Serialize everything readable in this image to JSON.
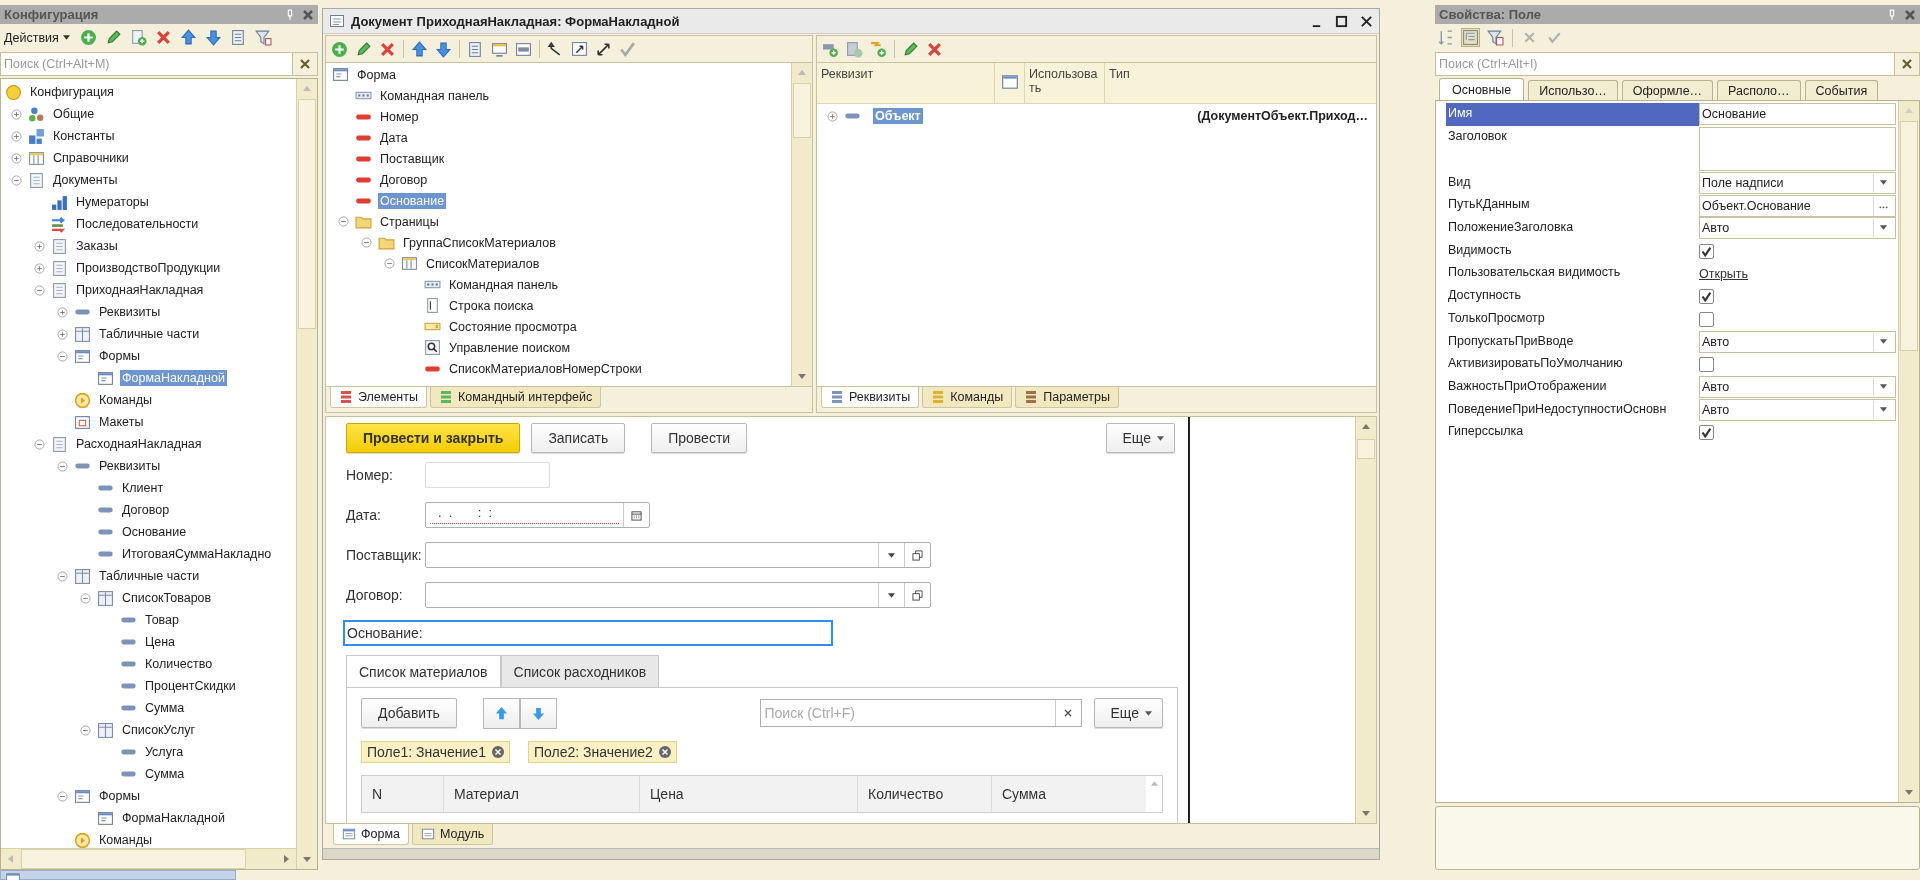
{
  "config_panel": {
    "title": "Конфигурация",
    "actions": "Действия",
    "search": {
      "placeholder": "Поиск (Ctrl+Alt+M)"
    },
    "tree": [
      {
        "label": "Конфигурация",
        "kind": "config",
        "selected": false,
        "children": [
          {
            "label": "Общие",
            "kind": "common",
            "expanded": false,
            "selected": false
          },
          {
            "label": "Константы",
            "kind": "constants",
            "expanded": false,
            "selected": false
          },
          {
            "label": "Справочники",
            "kind": "catalogs",
            "expanded": false,
            "selected": false
          },
          {
            "label": "Документы",
            "kind": "document",
            "expanded": true,
            "selected": false,
            "children": [
              {
                "label": "Нумераторы",
                "kind": "numerators",
                "selected": false
              },
              {
                "label": "Последовательности",
                "kind": "sequences",
                "selected": false
              },
              {
                "label": "Заказы",
                "kind": "document",
                "expanded": false,
                "selected": false
              },
              {
                "label": "ПроизводствоПродукции",
                "kind": "document",
                "expanded": false,
                "selected": false
              },
              {
                "label": "ПриходнаяНакладная",
                "kind": "document",
                "expanded": true,
                "selected": false,
                "children": [
                  {
                    "label": "Реквизиты",
                    "kind": "attr",
                    "expanded": false,
                    "selected": false
                  },
                  {
                    "label": "Табличные части",
                    "kind": "tabular",
                    "expanded": false,
                    "selected": false
                  },
                  {
                    "label": "Формы",
                    "kind": "form",
                    "expanded": true,
                    "selected": false,
                    "children": [
                      {
                        "label": "ФормаНакладной",
                        "kind": "form",
                        "selected": true
                      }
                    ]
                  },
                  {
                    "label": "Команды",
                    "kind": "commands",
                    "selected": false
                  },
                  {
                    "label": "Макеты",
                    "kind": "layouts",
                    "selected": false
                  }
                ]
              },
              {
                "label": "РасходнаяНакладная",
                "kind": "document",
                "expanded": true,
                "selected": false,
                "children": [
                  {
                    "label": "Реквизиты",
                    "kind": "attr",
                    "expanded": true,
                    "selected": false,
                    "children": [
                      {
                        "label": "Клиент",
                        "kind": "attr",
                        "selected": false
                      },
                      {
                        "label": "Договор",
                        "kind": "attr",
                        "selected": false
                      },
                      {
                        "label": "Основание",
                        "kind": "attr",
                        "selected": false
                      },
                      {
                        "label": "ИтоговаяСуммаНакладно",
                        "kind": "attr",
                        "selected": false
                      }
                    ]
                  },
                  {
                    "label": "Табличные части",
                    "kind": "tabular",
                    "expanded": true,
                    "selected": false,
                    "children": [
                      {
                        "label": "СписокТоваров",
                        "kind": "tabular",
                        "expanded": true,
                        "selected": false,
                        "children": [
                          {
                            "label": "Товар",
                            "kind": "attr",
                            "selected": false
                          },
                          {
                            "label": "Цена",
                            "kind": "attr",
                            "selected": false
                          },
                          {
                            "label": "Количество",
                            "kind": "attr",
                            "selected": false
                          },
                          {
                            "label": "ПроцентСкидки",
                            "kind": "attr",
                            "selected": false
                          },
                          {
                            "label": "Сумма",
                            "kind": "attr",
                            "selected": false
                          }
                        ]
                      },
                      {
                        "label": "СписокУслуг",
                        "kind": "tabular",
                        "expanded": true,
                        "selected": false,
                        "children": [
                          {
                            "label": "Услуга",
                            "kind": "attr",
                            "selected": false
                          },
                          {
                            "label": "Сумма",
                            "kind": "attr",
                            "selected": false
                          }
                        ]
                      }
                    ]
                  },
                  {
                    "label": "Формы",
                    "kind": "form",
                    "expanded": true,
                    "selected": false,
                    "children": [
                      {
                        "label": "ФормаНакладной",
                        "kind": "form",
                        "selected": false
                      }
                    ]
                  },
                  {
                    "label": "Команды",
                    "kind": "commands",
                    "selected": false
                  }
                ]
              }
            ]
          }
        ]
      }
    ]
  },
  "designer": {
    "title": "Документ ПриходнаяНакладная: ФормаНакладной",
    "elements_tree": [
      {
        "label": "Форма",
        "kind": "form",
        "selected": false,
        "children": [
          {
            "label": "Командная панель",
            "kind": "cmdpanel",
            "selected": false
          },
          {
            "label": "Номер",
            "kind": "field",
            "selected": false
          },
          {
            "label": "Дата",
            "kind": "field",
            "selected": false
          },
          {
            "label": "Поставщик",
            "kind": "field",
            "selected": false
          },
          {
            "label": "Договор",
            "kind": "field",
            "selected": false
          },
          {
            "label": "Основание",
            "kind": "field",
            "selected": true
          },
          {
            "label": "Страницы",
            "kind": "folder",
            "expanded": true,
            "selected": false,
            "children": [
              {
                "label": "ГруппаСписокМатериалов",
                "kind": "folder",
                "expanded": true,
                "selected": false,
                "children": [
                  {
                    "label": "СписокМатериалов",
                    "kind": "catalogs",
                    "expanded": true,
                    "selected": false,
                    "children": [
                      {
                        "label": "Командная панель",
                        "kind": "cmdpanel",
                        "selected": false
                      },
                      {
                        "label": "Строка поиска",
                        "kind": "searchstr",
                        "selected": false
                      },
                      {
                        "label": "Состояние просмотра",
                        "kind": "viewstate",
                        "selected": false
                      },
                      {
                        "label": "Управление поиском",
                        "kind": "searchctl",
                        "selected": false
                      },
                      {
                        "label": "СписокМатериаловНомерСтроки",
                        "kind": "field",
                        "selected": false
                      }
                    ]
                  }
                ]
              }
            ]
          }
        ]
      }
    ],
    "attributes": {
      "columns": [
        "Реквизит",
        "Использовать",
        "Тип"
      ],
      "rows": [
        {
          "name": "Объект",
          "type": "(ДокументОбъект.Приход…",
          "expanded": false,
          "selected": true
        }
      ]
    },
    "left_tabs": [
      {
        "label": "Элементы",
        "selected": true
      },
      {
        "label": "Командный интерфейс",
        "selected": false
      }
    ],
    "right_tabs": [
      {
        "label": "Реквизиты",
        "selected": true
      },
      {
        "label": "Команды",
        "selected": false
      },
      {
        "label": "Параметры",
        "selected": false
      }
    ],
    "form_preview": {
      "command_bar": [
        {
          "label": "Провести и закрыть",
          "kind": "default"
        },
        {
          "label": "Записать",
          "kind": "normal"
        },
        {
          "label": "Провести",
          "kind": "normal"
        }
      ],
      "more": "Еще",
      "fields": [
        {
          "label": "Номер:",
          "kind": "input"
        },
        {
          "label": "Дата:",
          "kind": "date",
          "value": ".  .       :  :"
        },
        {
          "label": "Поставщик:",
          "kind": "select"
        },
        {
          "label": "Договор:",
          "kind": "select"
        },
        {
          "label": "Основание:",
          "kind": "label"
        }
      ],
      "tabs": [
        {
          "label": "Список материалов",
          "selected": true
        },
        {
          "label": "Список расходников",
          "selected": false
        }
      ],
      "table_bar": {
        "add": "Добавить",
        "search": {
          "placeholder": "Поиск (Ctrl+F)"
        },
        "more": "Еще"
      },
      "filters": [
        "Поле1: Значение1",
        "Поле2: Значение2"
      ],
      "columns": [
        "N",
        "Материал",
        "Цена",
        "Количество",
        "Сумма"
      ]
    },
    "bottom_tabs": [
      {
        "label": "Форма",
        "selected": true
      },
      {
        "label": "Модуль",
        "selected": false
      }
    ]
  },
  "properties_panel": {
    "title": "Свойства: Поле",
    "search": {
      "placeholder": "Поиск (Ctrl+Alt+I)"
    },
    "tabs": [
      {
        "label": "Основные",
        "selected": true
      },
      {
        "label": "Использо…",
        "selected": false
      },
      {
        "label": "Оформле…",
        "selected": false
      },
      {
        "label": "Располо…",
        "selected": false
      },
      {
        "label": "События",
        "selected": false
      }
    ],
    "rows": [
      {
        "name": "Имя",
        "kind": "text",
        "value": "Основание",
        "selected": true
      },
      {
        "name": "Заголовок",
        "kind": "textarea",
        "selected": false
      },
      {
        "name": "Вид",
        "kind": "select",
        "value": "Поле надписи",
        "selected": false
      },
      {
        "name": "ПутьКДанным",
        "kind": "path",
        "value": "Объект.Основание",
        "selected": false
      },
      {
        "name": "ПоложениеЗаголовка",
        "kind": "select",
        "value": "Авто",
        "selected": false
      },
      {
        "name": "Видимость",
        "kind": "check",
        "checked": true,
        "selected": false
      },
      {
        "name": "Пользовательская видимость",
        "kind": "link",
        "value": "Открыть",
        "selected": false
      },
      {
        "name": "Доступность",
        "kind": "check",
        "checked": true,
        "selected": false
      },
      {
        "name": "ТолькоПросмотр",
        "kind": "check",
        "checked": false,
        "selected": false
      },
      {
        "name": "ПропускатьПриВводе",
        "kind": "select",
        "value": "Авто",
        "selected": false
      },
      {
        "name": "АктивизироватьПоУмолчанию",
        "kind": "check",
        "checked": false,
        "selected": false
      },
      {
        "name": "ВажностьПриОтображении",
        "kind": "select",
        "value": "Авто",
        "selected": false
      },
      {
        "name": "ПоведениеПриНедоступностиОсновн",
        "kind": "select",
        "value": "Авто",
        "selected": false
      },
      {
        "name": "Гиперссылка",
        "kind": "check",
        "checked": true,
        "selected": false
      }
    ]
  }
}
